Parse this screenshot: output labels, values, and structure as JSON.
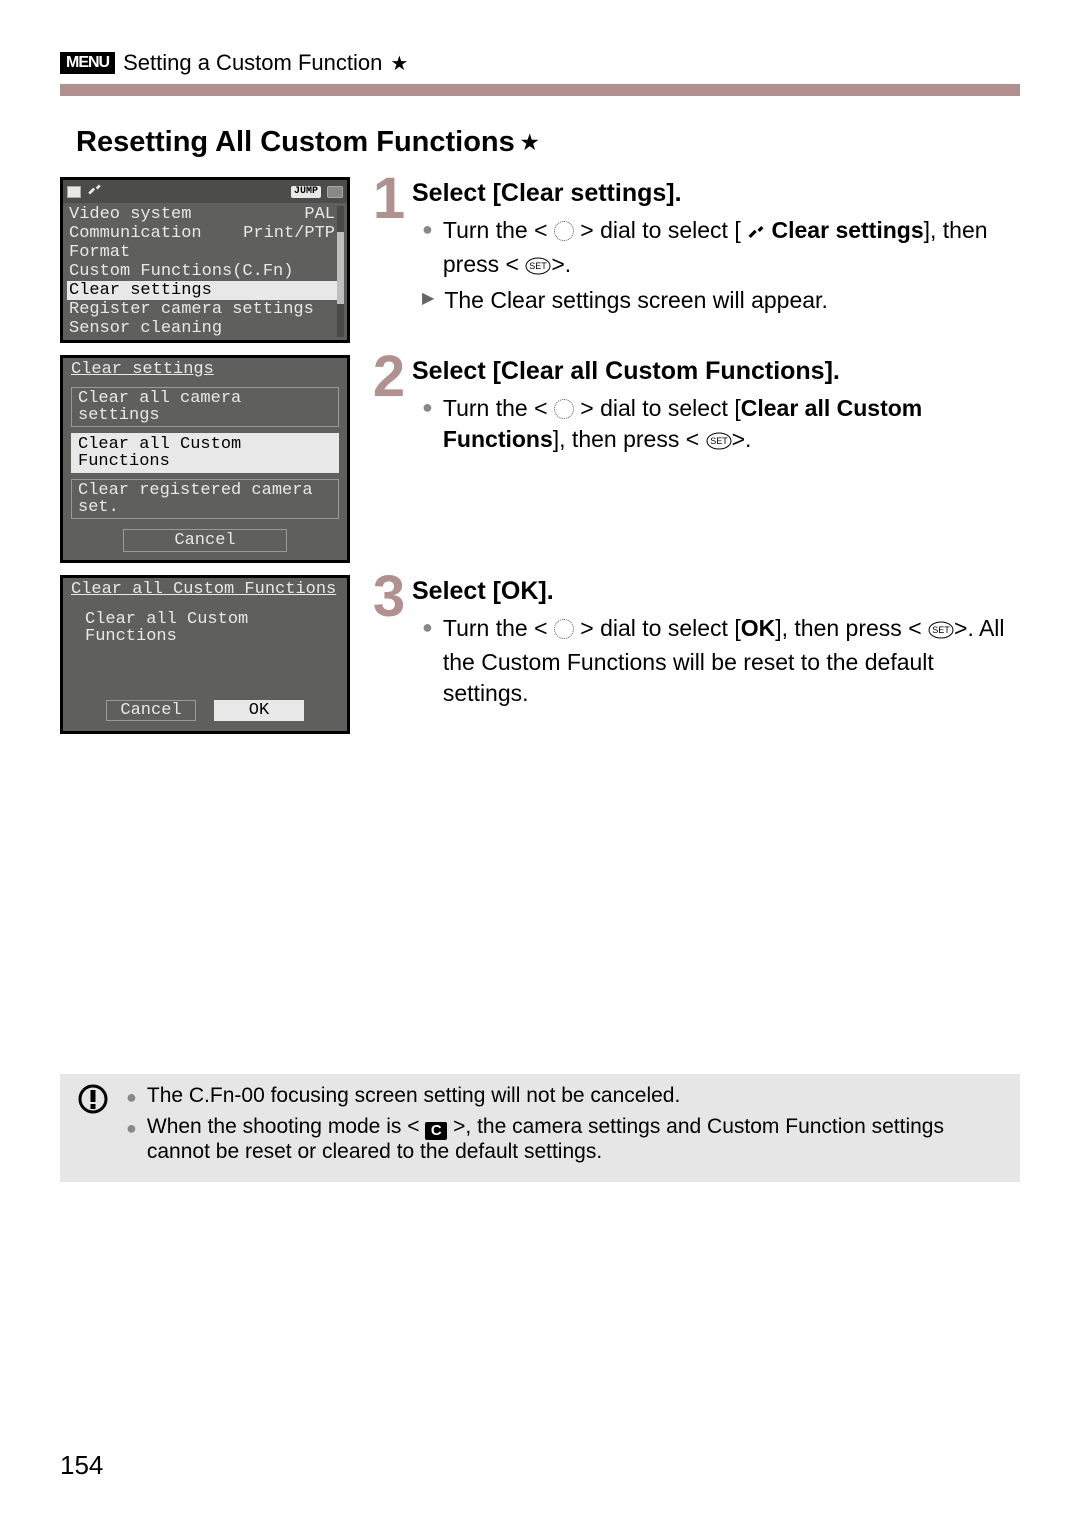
{
  "breadcrumb": {
    "menu_badge": "MENU",
    "title": "Setting a Custom Function"
  },
  "section_title": "Resetting All Custom Functions",
  "lcd1": {
    "jump": "JUMP",
    "rows": [
      {
        "label": "Video system",
        "value": "PAL"
      },
      {
        "label": "Communication",
        "value": "Print/PTP"
      },
      {
        "label": "Format",
        "value": ""
      },
      {
        "label": "Custom Functions(C.Fn)",
        "value": ""
      },
      {
        "label": "Clear settings",
        "value": "",
        "hl": true
      },
      {
        "label": "Register camera settings",
        "value": ""
      },
      {
        "label": "Sensor cleaning",
        "value": ""
      }
    ]
  },
  "lcd2": {
    "title": "Clear settings",
    "options": [
      {
        "label": "Clear all camera settings"
      },
      {
        "label": "Clear all Custom Functions",
        "active": true
      },
      {
        "label": "Clear registered camera set."
      }
    ],
    "cancel": "Cancel"
  },
  "lcd3": {
    "title": "Clear all Custom Functions",
    "subtitle": "Clear all Custom Functions",
    "cancel": "Cancel",
    "ok": "OK"
  },
  "steps": {
    "s1": {
      "num": "1",
      "title": "Select [Clear settings].",
      "line1a": "Turn the <",
      "line1b": "> dial to select [",
      "line1c": "Clear settings",
      "line1d": "], then press <",
      "line1e": ">.",
      "line2": "The Clear settings screen will appear."
    },
    "s2": {
      "num": "2",
      "title": "Select [Clear all Custom Functions].",
      "line1a": "Turn the <",
      "line1b": "> dial to select [",
      "line1c": "Clear all Custom Functions",
      "line1d": "], then press",
      "line1e": "<",
      "line1f": ">."
    },
    "s3": {
      "num": "3",
      "title": "Select [OK].",
      "line1a": "Turn the <",
      "line1b": "> dial to select [",
      "line1c": "OK",
      "line1d": "], then press <",
      "line1e": ">. All the Custom Functions will be reset to the default settings."
    }
  },
  "note": {
    "l1": "The C.Fn-00 focusing screen setting will not be canceled.",
    "l2a": "When the shooting mode is <",
    "l2b": ">, the camera settings and Custom Function settings cannot be reset or cleared to the default settings."
  },
  "page_number": "154",
  "icons": {
    "set_label": "SET",
    "c_label": "C"
  }
}
